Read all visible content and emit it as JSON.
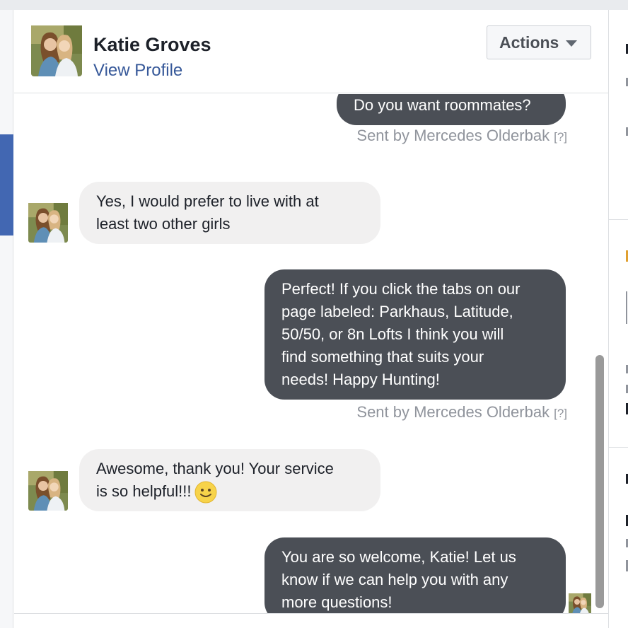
{
  "header": {
    "contact_name": "Katie Groves",
    "profile_link": "View Profile",
    "actions_label": "Actions"
  },
  "messages": [
    {
      "direction": "outgoing",
      "text": "Do you want roommates?",
      "sent_by": "Sent by Mercedes Olderbak",
      "help": "[?]"
    },
    {
      "direction": "incoming",
      "lines": [
        "Yes, I would prefer to live with at",
        "least two other girls"
      ]
    },
    {
      "direction": "outgoing",
      "lines": [
        "Perfect! If you click the tabs on our",
        "page labeled: Parkhaus, Latitude,",
        "50/50, or 8n Lofts I think you will",
        "find something that suits your",
        "needs! Happy Hunting!"
      ],
      "sent_by": "Sent by Mercedes Olderbak",
      "help": "[?]"
    },
    {
      "direction": "incoming",
      "lines": [
        "Awesome, thank you! Your service",
        "is so helpful!!!"
      ],
      "emoji": "slightly-smiling-face"
    },
    {
      "direction": "outgoing",
      "lines": [
        "You are so welcome, Katie! Let us",
        "know if we can help you with any",
        "more questions!"
      ]
    }
  ],
  "colors": {
    "outgoing_bubble": "#4b4f56",
    "incoming_bubble": "#f1f0f0",
    "link": "#365899",
    "meta_text": "#90949c",
    "left_accent": "#4267b2"
  }
}
